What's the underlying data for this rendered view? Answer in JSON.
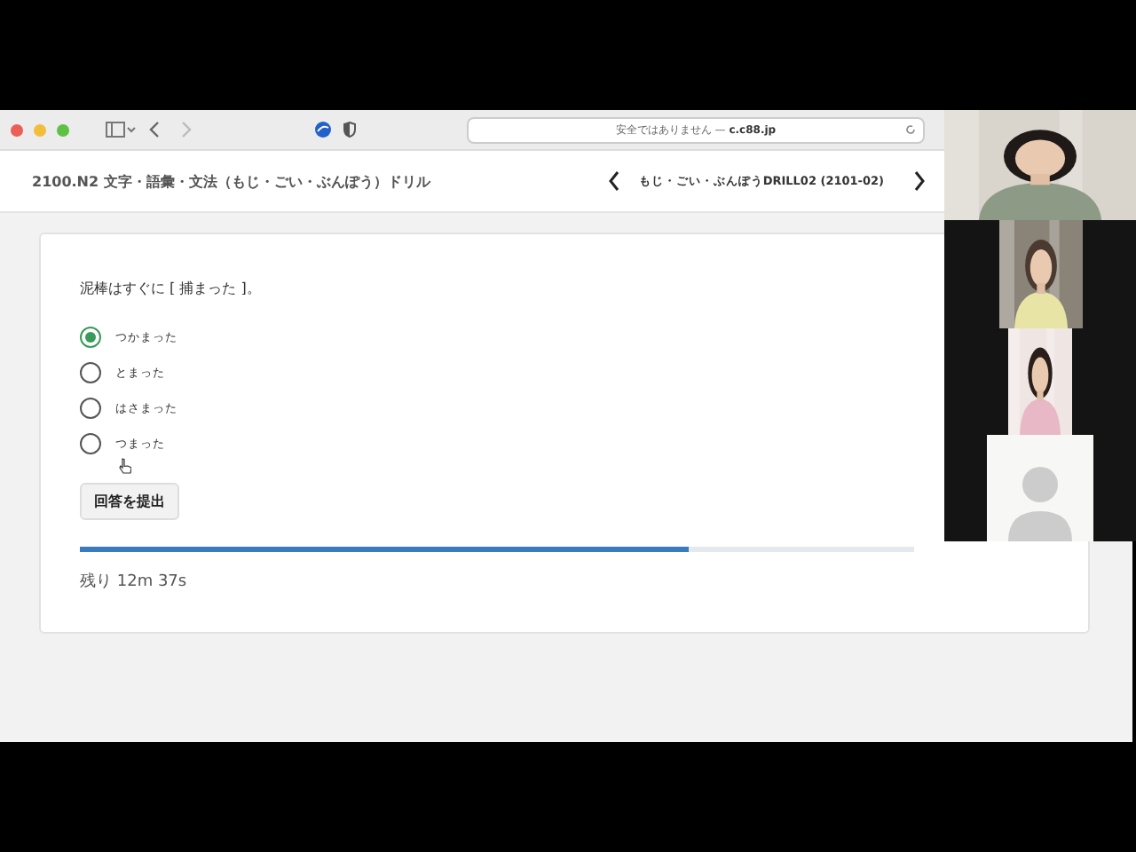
{
  "browser": {
    "address": "安全ではありません — **c.c88.jp**"
  },
  "header": {
    "title": "2100.N2 文字・語彙・文法（もじ・ごい・ぶんぽう）ドリル",
    "lesson": "もじ・ごい・ぶんぽうDRILL02 (2101-02)"
  },
  "quiz": {
    "question": "泥棒はすぐに [ 捕まった ]。",
    "options": [
      {
        "label": "つかまった",
        "selected": true
      },
      {
        "label": "とまった",
        "selected": false
      },
      {
        "label": "はさまった",
        "selected": false
      },
      {
        "label": "つまった",
        "selected": false
      }
    ],
    "submit": "回答を提出",
    "progress": {
      "level": 0.73
    },
    "remaining": "残り 12m 37s"
  },
  "video_tiles": [
    {
      "kind": "picture"
    },
    {
      "kind": "picture"
    },
    {
      "kind": "picture"
    },
    {
      "kind": "avatar"
    }
  ]
}
